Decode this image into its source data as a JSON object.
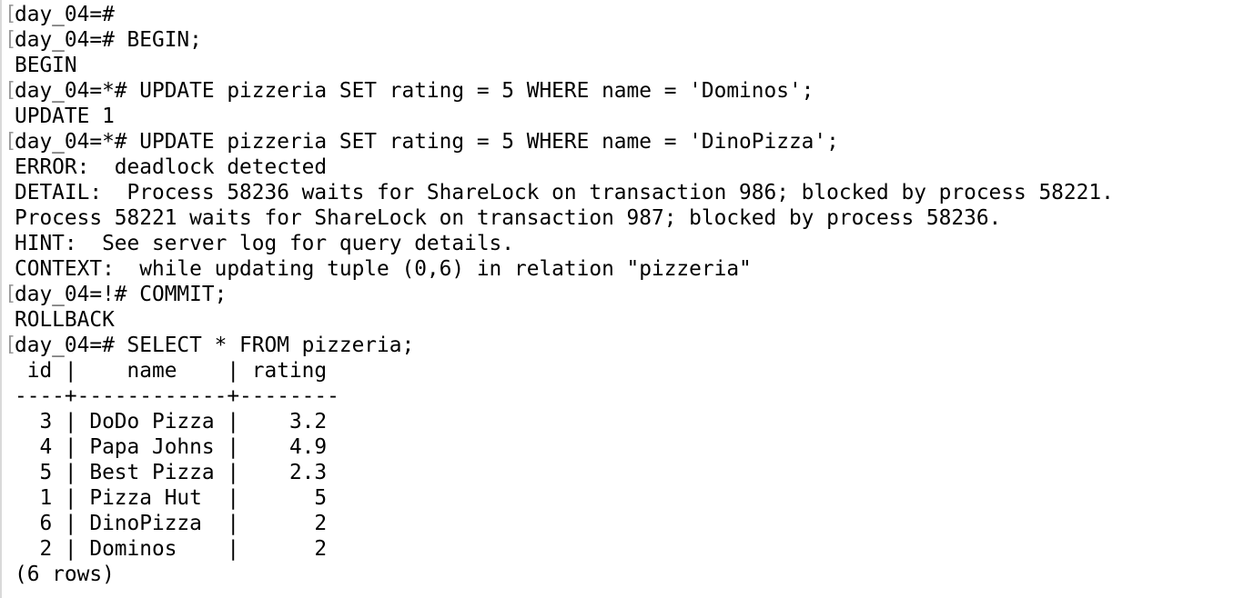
{
  "terminal": {
    "lines": [
      {
        "text": "day_04=#",
        "type": "cmd"
      },
      {
        "text": "day_04=# BEGIN;",
        "type": "cmd"
      },
      {
        "text": "BEGIN",
        "type": "out"
      },
      {
        "text": "day_04=*# UPDATE pizzeria SET rating = 5 WHERE name = 'Dominos';",
        "type": "cmd"
      },
      {
        "text": "UPDATE 1",
        "type": "out"
      },
      {
        "text": "day_04=*# UPDATE pizzeria SET rating = 5 WHERE name = 'DinoPizza';",
        "type": "cmd"
      },
      {
        "text": "ERROR:  deadlock detected",
        "type": "out"
      },
      {
        "text": "DETAIL:  Process 58236 waits for ShareLock on transaction 986; blocked by process 58221.",
        "type": "out"
      },
      {
        "text": "Process 58221 waits for ShareLock on transaction 987; blocked by process 58236.",
        "type": "out"
      },
      {
        "text": "HINT:  See server log for query details.",
        "type": "out"
      },
      {
        "text": "CONTEXT:  while updating tuple (0,6) in relation \"pizzeria\"",
        "type": "out"
      },
      {
        "text": "day_04=!# COMMIT;",
        "type": "cmd"
      },
      {
        "text": "ROLLBACK",
        "type": "out"
      },
      {
        "text": "day_04=# SELECT * FROM pizzeria;",
        "type": "cmd"
      },
      {
        "text": " id |    name    | rating",
        "type": "out"
      },
      {
        "text": "----+------------+--------",
        "type": "out"
      },
      {
        "text": "  3 | DoDo Pizza |    3.2",
        "type": "out"
      },
      {
        "text": "  4 | Papa Johns |    4.9",
        "type": "out"
      },
      {
        "text": "  5 | Best Pizza |    2.3",
        "type": "out"
      },
      {
        "text": "  1 | Pizza Hut  |      5",
        "type": "out"
      },
      {
        "text": "  6 | DinoPizza  |      2",
        "type": "out"
      },
      {
        "text": "  2 | Dominos    |      2",
        "type": "out"
      },
      {
        "text": "(6 rows)",
        "type": "out"
      }
    ]
  }
}
